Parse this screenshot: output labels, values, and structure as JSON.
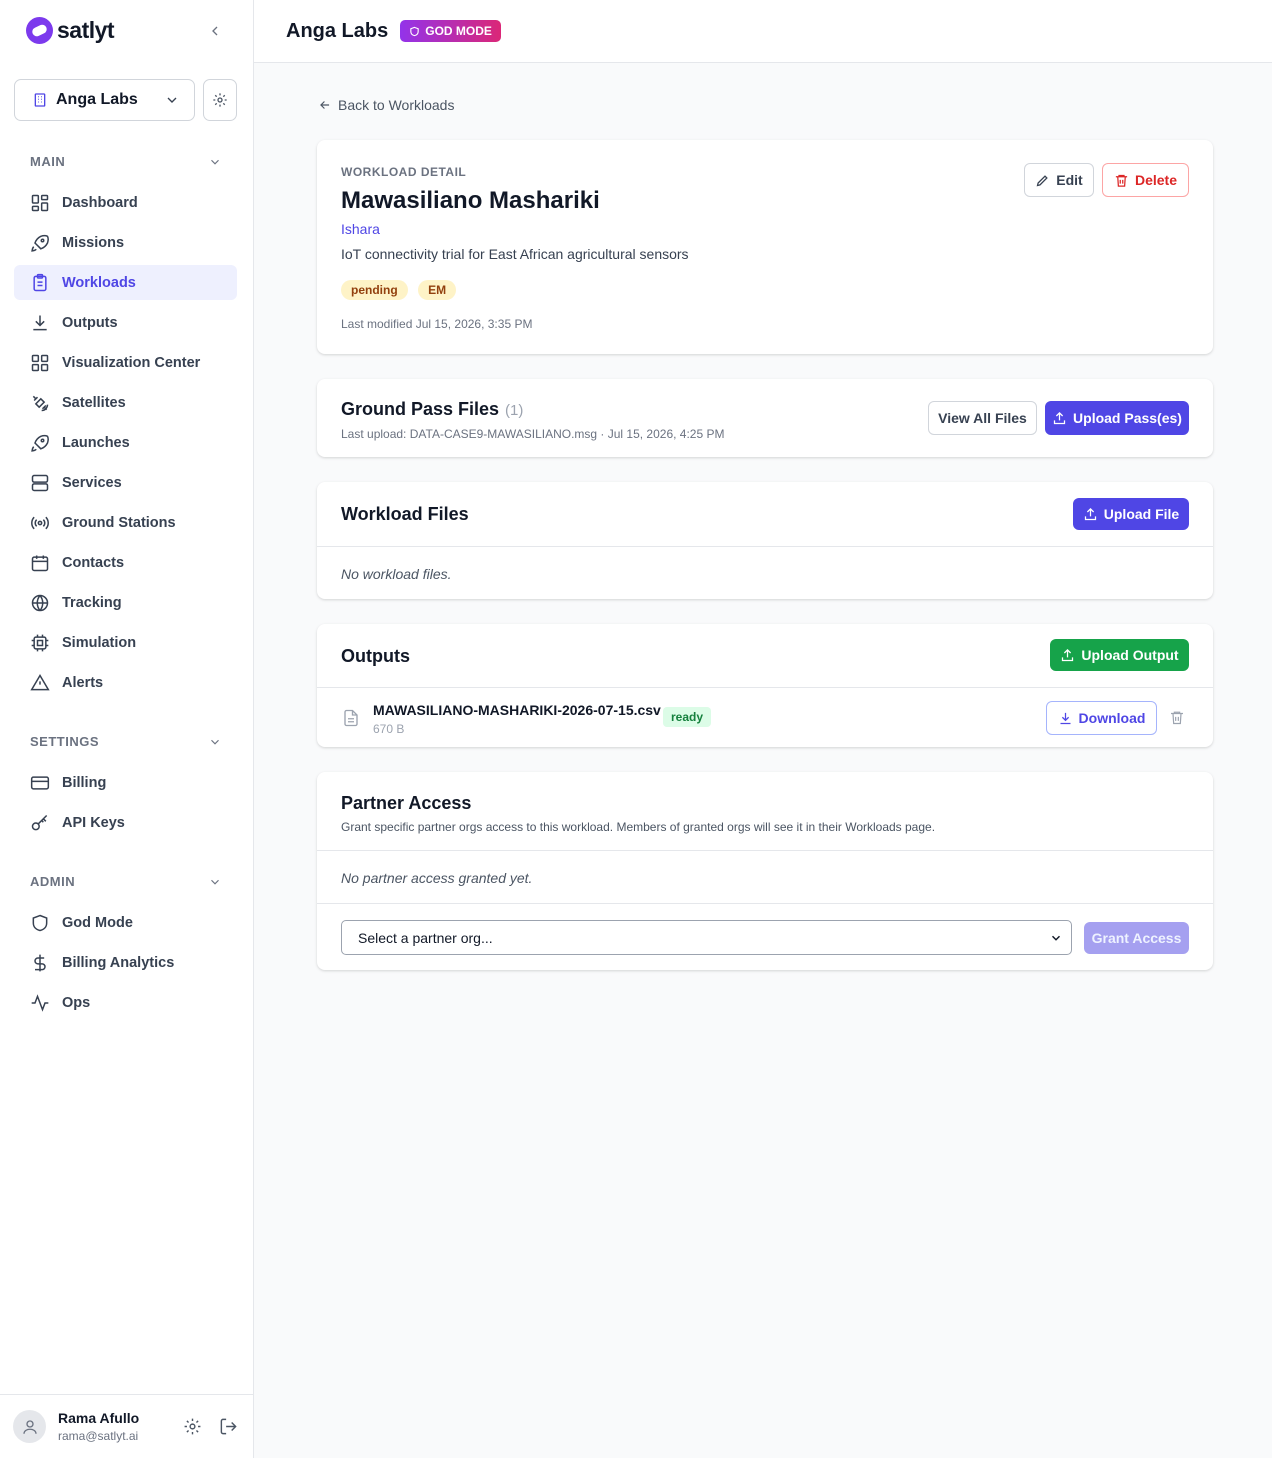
{
  "app": {
    "logo_text": "satlyt"
  },
  "sidebar": {
    "org_name": "Anga Labs",
    "sections": [
      {
        "title": "MAIN",
        "items": [
          {
            "label": "Dashboard",
            "icon": "dashboard-icon"
          },
          {
            "label": "Missions",
            "icon": "rocket-icon"
          },
          {
            "label": "Workloads",
            "icon": "clipboard-icon",
            "active": true
          },
          {
            "label": "Outputs",
            "icon": "download-icon"
          },
          {
            "label": "Visualization Center",
            "icon": "grid-icon"
          },
          {
            "label": "Satellites",
            "icon": "satellite-icon"
          },
          {
            "label": "Launches",
            "icon": "rocket-icon"
          },
          {
            "label": "Services",
            "icon": "server-icon"
          },
          {
            "label": "Ground Stations",
            "icon": "radio-icon"
          },
          {
            "label": "Contacts",
            "icon": "calendar-icon"
          },
          {
            "label": "Tracking",
            "icon": "globe-icon"
          },
          {
            "label": "Simulation",
            "icon": "cpu-icon"
          },
          {
            "label": "Alerts",
            "icon": "alert-icon"
          }
        ]
      },
      {
        "title": "SETTINGS",
        "items": [
          {
            "label": "Billing",
            "icon": "credit-card-icon"
          },
          {
            "label": "API Keys",
            "icon": "key-icon"
          }
        ]
      },
      {
        "title": "ADMIN",
        "items": [
          {
            "label": "God Mode",
            "icon": "shield-icon"
          },
          {
            "label": "Billing Analytics",
            "icon": "dollar-icon"
          },
          {
            "label": "Ops",
            "icon": "activity-icon"
          }
        ]
      }
    ],
    "user": {
      "name": "Rama Afullo",
      "email": "rama@satlyt.ai"
    }
  },
  "header": {
    "org_title": "Anga Labs",
    "badge": "GOD MODE"
  },
  "back_link": "Back to Workloads",
  "workload": {
    "eyebrow": "WORKLOAD DETAIL",
    "title": "Mawasiliano Mashariki",
    "owner": "Ishara",
    "description": "IoT connectivity trial for East African agricultural sensors",
    "tags": [
      "pending",
      "EM"
    ],
    "last_modified": "Last modified Jul 15, 2026, 3:35 PM",
    "edit_label": "Edit",
    "delete_label": "Delete"
  },
  "ground_pass": {
    "title": "Ground Pass Files",
    "count": "(1)",
    "last_upload": "Last upload: DATA-CASE9-MAWASILIANO.msg · Jul 15, 2026, 4:25 PM",
    "view_all_label": "View All Files",
    "upload_label": "Upload Pass(es)"
  },
  "workload_files": {
    "title": "Workload Files",
    "upload_label": "Upload File",
    "empty": "No workload files."
  },
  "outputs": {
    "title": "Outputs",
    "upload_label": "Upload Output",
    "files": [
      {
        "name": "MAWASILIANO-MASHARIKI-2026-07-15.csv",
        "size": "670 B",
        "status": "ready",
        "download_label": "Download"
      }
    ]
  },
  "partner_access": {
    "title": "Partner Access",
    "subtitle": "Grant specific partner orgs access to this workload. Members of granted orgs will see it in their Workloads page.",
    "empty": "No partner access granted yet.",
    "select_placeholder": "Select a partner org...",
    "grant_label": "Grant Access"
  },
  "colors": {
    "accent": "#4f46e5",
    "success": "#16a34a",
    "danger": "#dc2626",
    "badge_from": "#9333ea",
    "badge_to": "#db2777"
  }
}
